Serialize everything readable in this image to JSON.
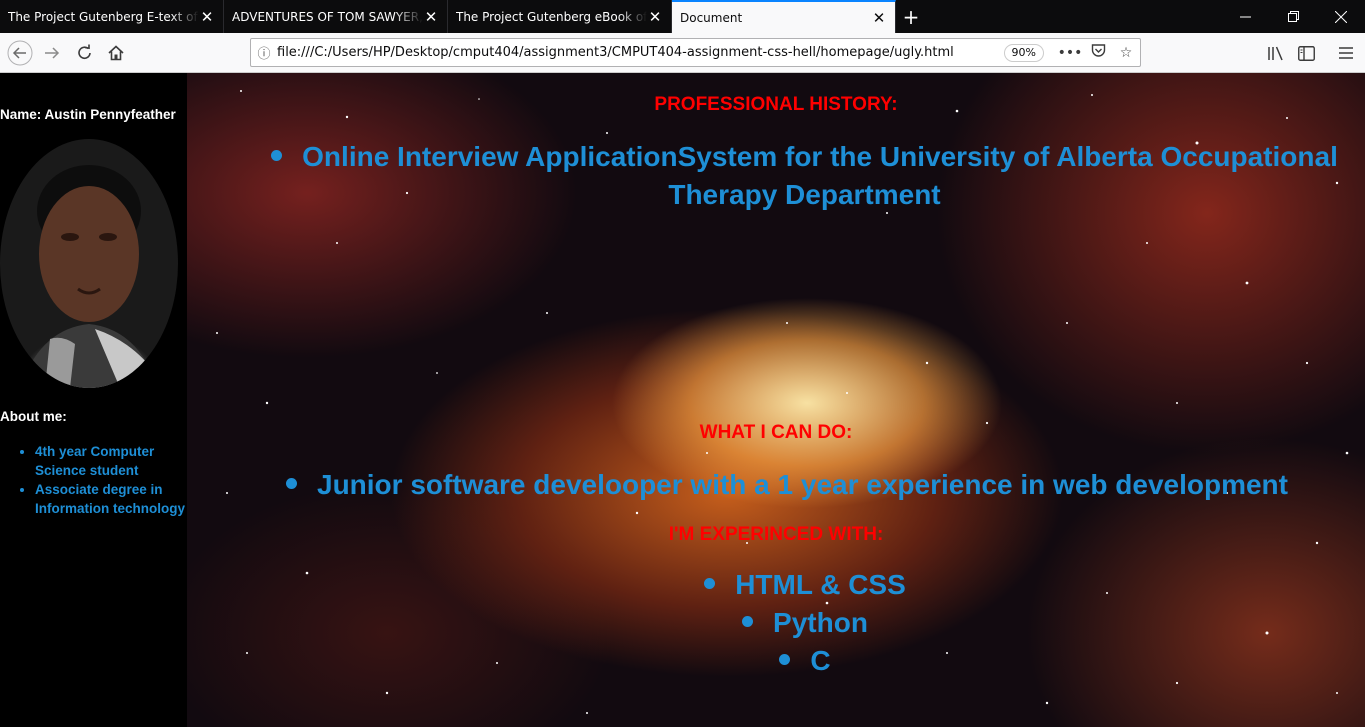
{
  "browser": {
    "tabs": [
      {
        "title": "The Project Gutenberg E-text of Frankenstein",
        "active": false
      },
      {
        "title": "ADVENTURES OF TOM SAWYER, By",
        "active": false
      },
      {
        "title": "The Project Gutenberg eBook of Au",
        "active": false
      },
      {
        "title": "Document",
        "active": true
      }
    ],
    "new_tab_icon": "+",
    "url": "file:///C:/Users/HP/Desktop/cmput404/assignment3/CMPUT404-assignment-css-hell/homepage/ugly.html",
    "zoom": "90%"
  },
  "sidebar": {
    "name": "Name: Austin Pennyfeather",
    "about_heading": "About me:",
    "about_items": [
      "4th year Computer Science student",
      "Associate degree in Information technology"
    ]
  },
  "main": {
    "professional_heading": "PROFESSIONAL HISTORY:",
    "professional_items": [
      "Online Interview ApplicationSystem for the University of Alberta Occupational Therapy Department"
    ],
    "can_do_heading": "WHAT I CAN DO:",
    "can_do_items": [
      "Junior software develooper with a 1 year experience in web development"
    ],
    "experienced_heading": "I'M EXPERINCED WITH:",
    "skills": [
      "HTML & CSS",
      "Python",
      "C"
    ]
  },
  "colors": {
    "heading": "#ff0000",
    "item_text": "#1e8fd6",
    "sidebar_bg": "#000000",
    "tab_accent": "#0a84ff"
  }
}
